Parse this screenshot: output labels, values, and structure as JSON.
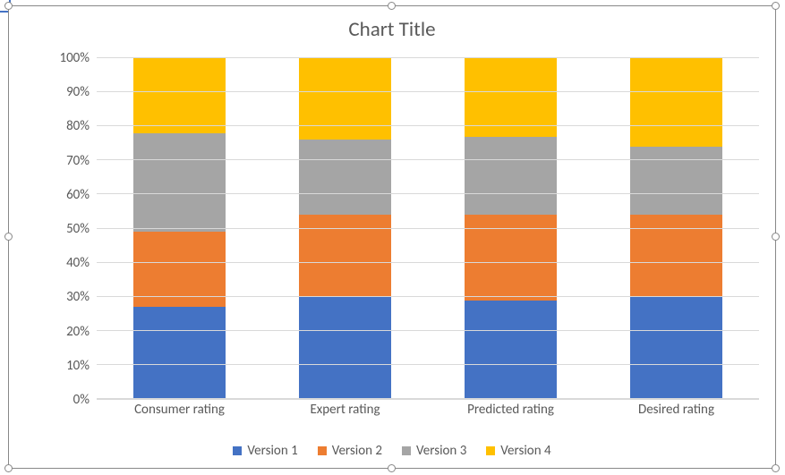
{
  "chart_data": {
    "type": "bar",
    "stacked": "percent",
    "title": "Chart Title",
    "xlabel": "",
    "ylabel": "",
    "ylim": [
      0,
      100
    ],
    "y_ticks": [
      "0%",
      "10%",
      "20%",
      "30%",
      "40%",
      "50%",
      "60%",
      "70%",
      "80%",
      "90%",
      "100%"
    ],
    "categories": [
      "Consumer rating",
      "Expert rating",
      "Predicted rating",
      "Desired rating"
    ],
    "series": [
      {
        "name": "Version 1",
        "color": "#4472c4",
        "values": [
          27,
          30,
          29,
          30
        ]
      },
      {
        "name": "Version 2",
        "color": "#ed7d31",
        "values": [
          22,
          24,
          25,
          24
        ]
      },
      {
        "name": "Version 3",
        "color": "#a5a5a5",
        "values": [
          29,
          22,
          23,
          20
        ]
      },
      {
        "name": "Version 4",
        "color": "#ffc000",
        "values": [
          22,
          24,
          23,
          26
        ]
      }
    ],
    "legend_position": "bottom",
    "grid": true
  }
}
